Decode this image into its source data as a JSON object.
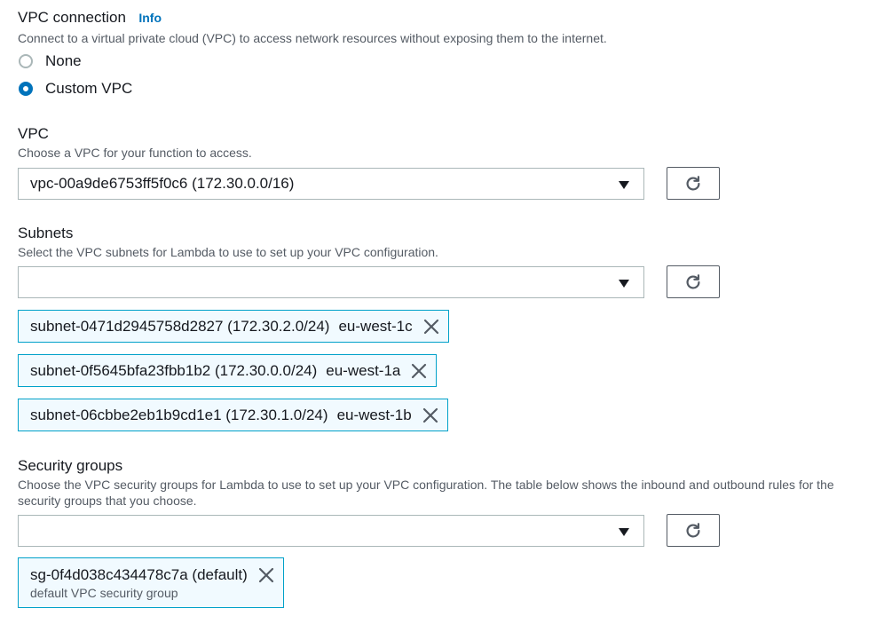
{
  "vpc_connection": {
    "title": "VPC connection",
    "info": "Info",
    "description": "Connect to a virtual private cloud (VPC) to access network resources without exposing them to the internet.",
    "options": [
      {
        "label": "None",
        "selected": false
      },
      {
        "label": "Custom VPC",
        "selected": true
      }
    ]
  },
  "vpc": {
    "title": "VPC",
    "description": "Choose a VPC for your function to access.",
    "selected_value": "vpc-00a9de6753ff5f0c6 (172.30.0.0/16)"
  },
  "subnets": {
    "title": "Subnets",
    "description": "Select the VPC subnets for Lambda to use to set up your VPC configuration.",
    "selected_value": "",
    "tokens": [
      {
        "name": "subnet-0471d2945758d2827 (172.30.2.0/24)",
        "az": "eu-west-1c"
      },
      {
        "name": "subnet-0f5645bfa23fbb1b2 (172.30.0.0/24)",
        "az": "eu-west-1a"
      },
      {
        "name": "subnet-06cbbe2eb1b9cd1e1 (172.30.1.0/24)",
        "az": "eu-west-1b"
      }
    ]
  },
  "security_groups": {
    "title": "Security groups",
    "description": "Choose the VPC security groups for Lambda to use to set up your VPC configuration. The table below shows the inbound and outbound rules for the security groups that you choose.",
    "selected_value": "",
    "tokens": [
      {
        "name": "sg-0f4d038c434478c7a (default)",
        "description": "default VPC security group"
      }
    ]
  },
  "icons": {
    "refresh": "refresh-icon",
    "caret": "caret-down-icon",
    "remove": "close-icon"
  },
  "colors": {
    "accent": "#0073bb",
    "token_border": "#00a1c9",
    "token_bg": "#f1faff",
    "muted_text": "#545b64"
  }
}
